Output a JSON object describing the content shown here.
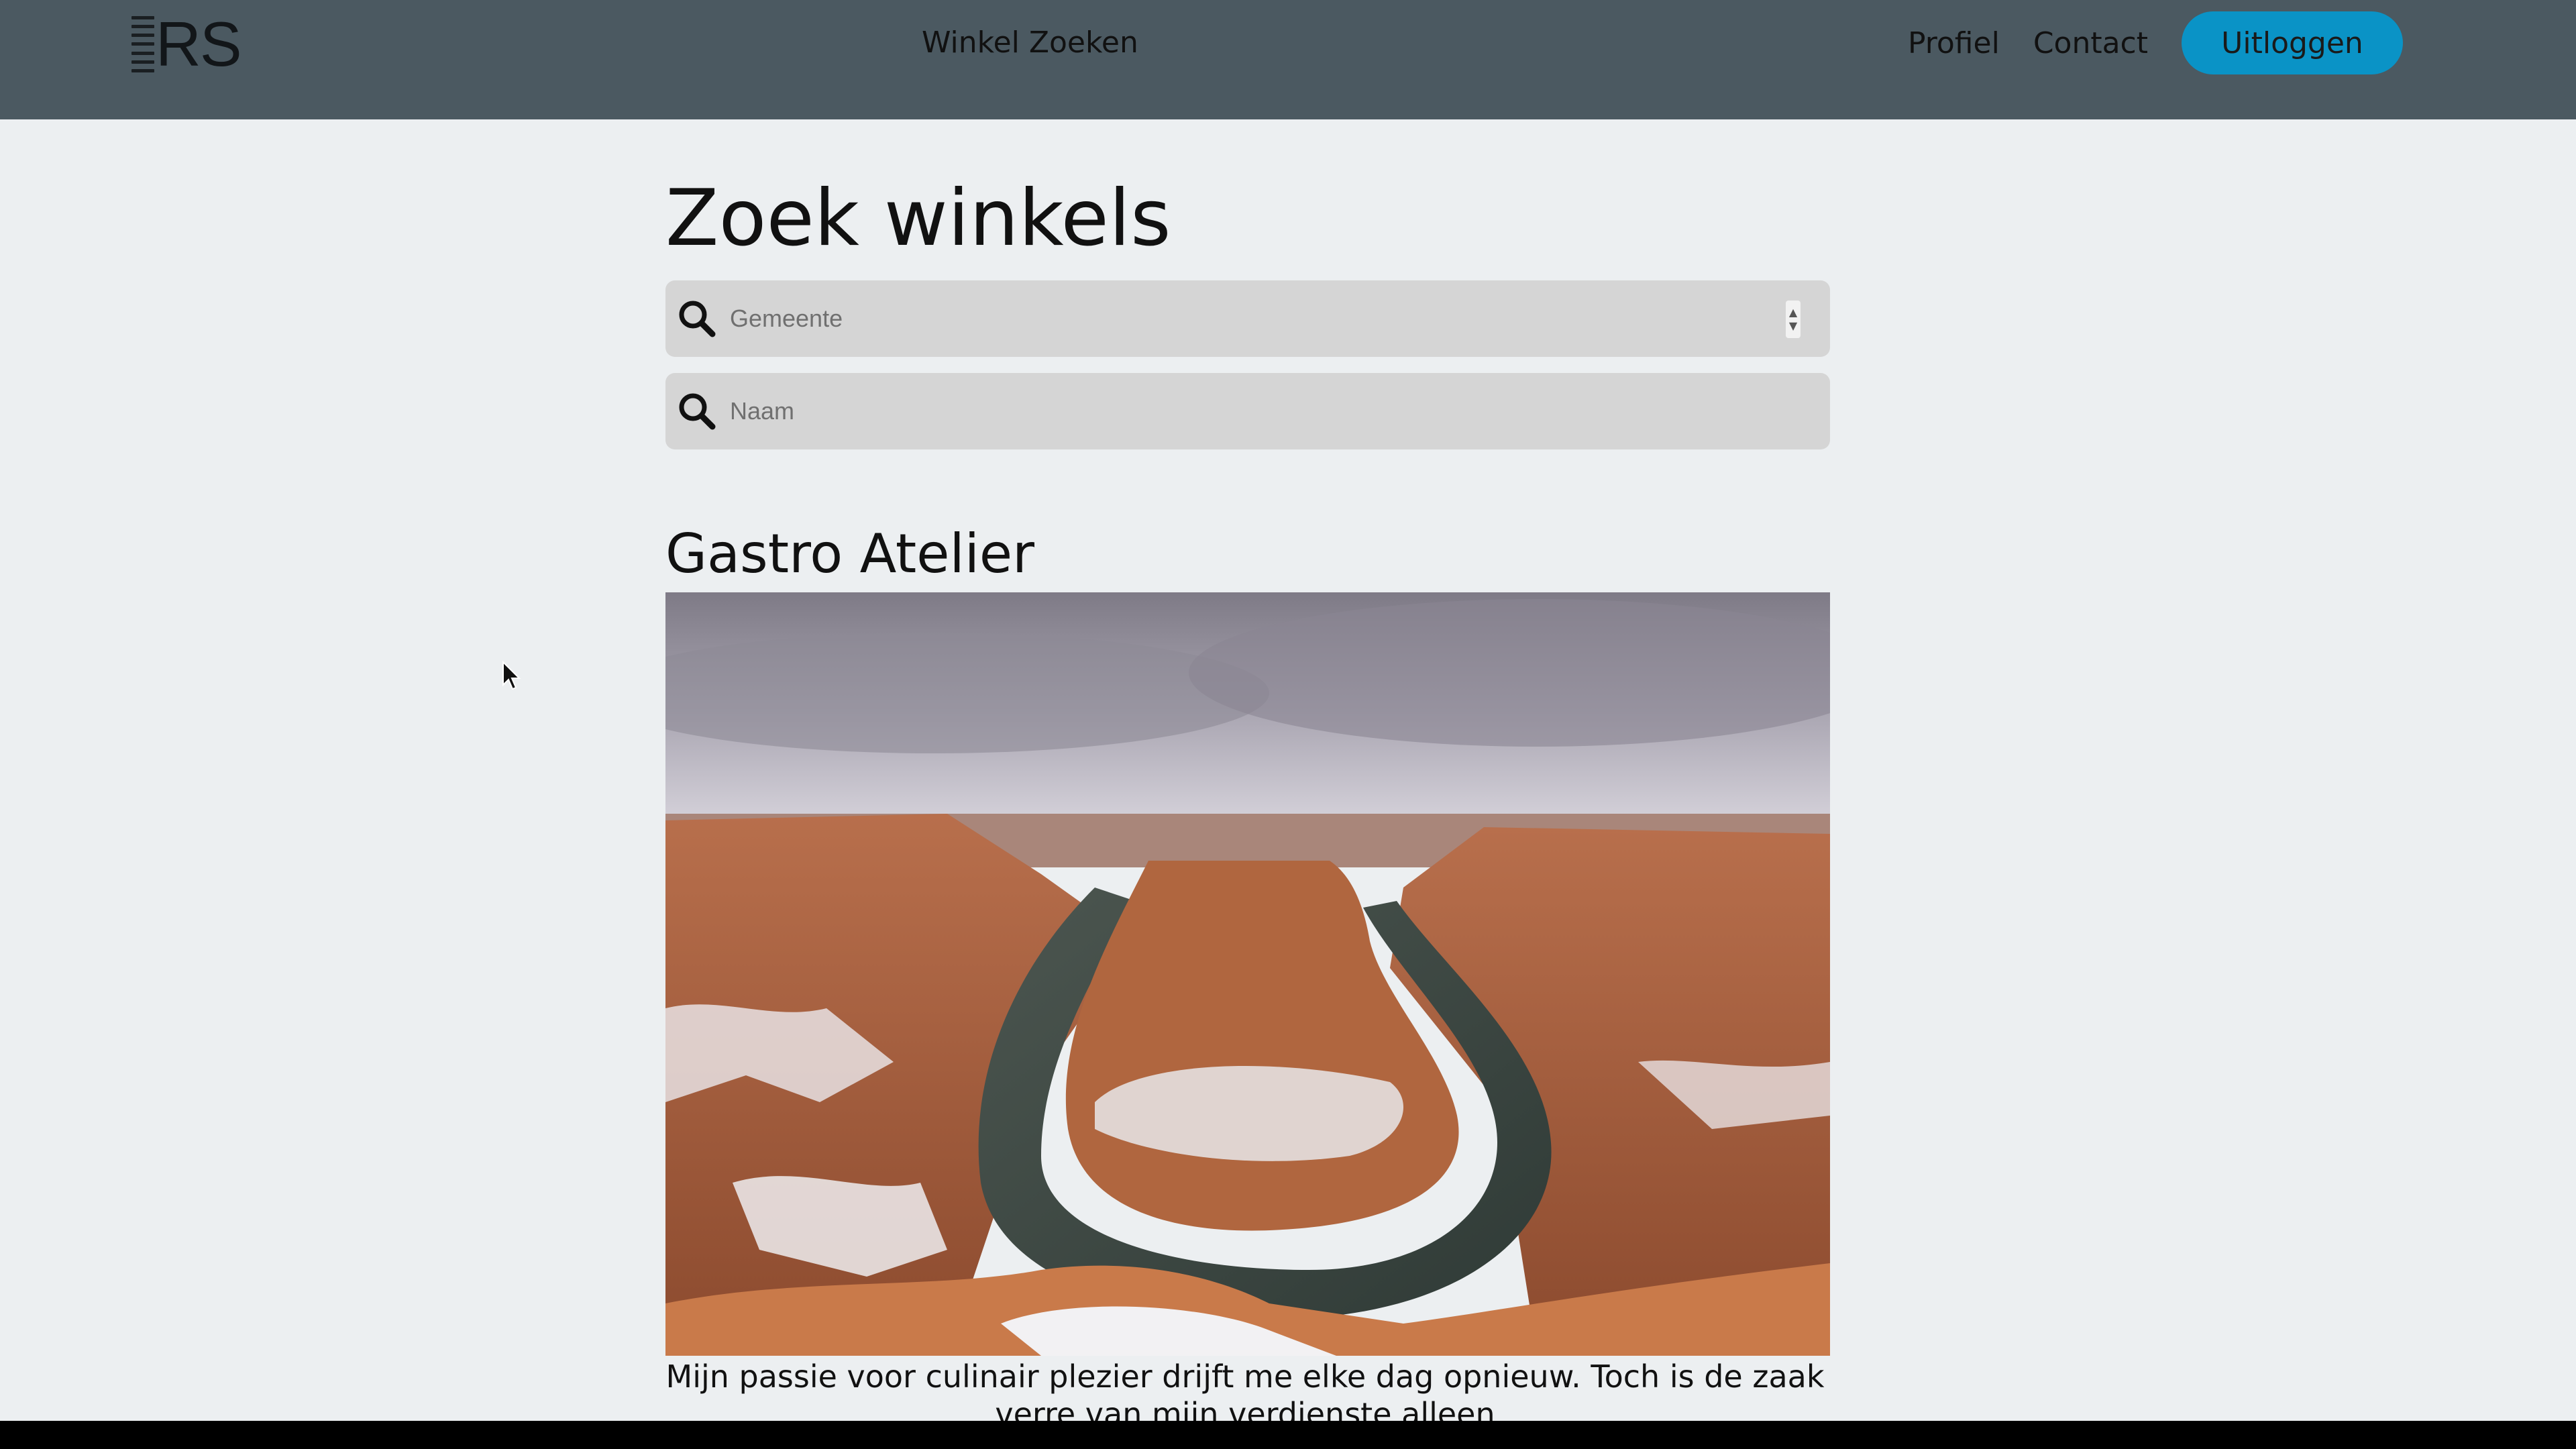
{
  "nav": {
    "logo_text": "RS",
    "center_link": "Winkel Zoeken",
    "profile": "Profiel",
    "contact": "Contact",
    "logout": "Uitloggen"
  },
  "page": {
    "title": "Zoek winkels",
    "gemeente_placeholder": "Gemeente",
    "naam_placeholder": "Naam"
  },
  "shop": {
    "name": "Gastro Atelier",
    "description": "Mijn passie voor culinair plezier drijft me elke dag opnieuw. Toch is de zaak verre van mijn verdienste alleen"
  },
  "colors": {
    "navbar": "#4b5961",
    "accent": "#0a93c6",
    "background": "#eceff1"
  }
}
